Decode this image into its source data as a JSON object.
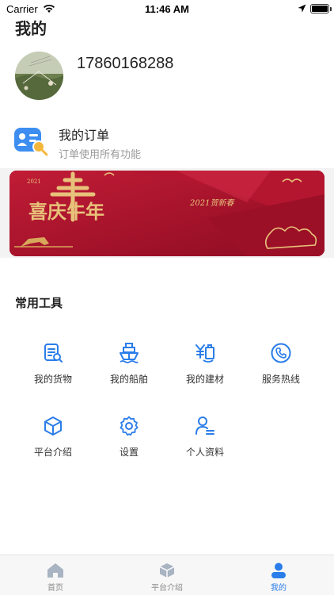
{
  "status_bar": {
    "carrier": "Carrier",
    "time": "11:46 AM"
  },
  "page": {
    "title": "我的"
  },
  "profile": {
    "phone": "17860168288"
  },
  "order": {
    "title": "我的订单",
    "subtitle": "订单使用所有功能"
  },
  "banner": {
    "year": "2021",
    "main_text": "喜庆牛年",
    "greeting": "2021贺新春"
  },
  "tools": {
    "section_title": "常用工具",
    "items": [
      {
        "label": "我的货物",
        "icon": "cargo-icon"
      },
      {
        "label": "我的船舶",
        "icon": "ship-icon"
      },
      {
        "label": "我的建材",
        "icon": "building-materials-icon"
      },
      {
        "label": "服务热线",
        "icon": "phone-icon"
      },
      {
        "label": "平台介绍",
        "icon": "box-icon"
      },
      {
        "label": "设置",
        "icon": "gear-icon"
      },
      {
        "label": "个人资料",
        "icon": "profile-icon"
      }
    ]
  },
  "tabbar": {
    "items": [
      {
        "label": "首页",
        "icon": "home-icon",
        "active": false
      },
      {
        "label": "平台介绍",
        "icon": "box-icon",
        "active": false
      },
      {
        "label": "我的",
        "icon": "user-icon",
        "active": true
      }
    ]
  },
  "colors": {
    "accent": "#2b7de9",
    "banner_red": "#a9132b",
    "gold": "#e8c27a",
    "muted_text": "#9a9a9a"
  }
}
